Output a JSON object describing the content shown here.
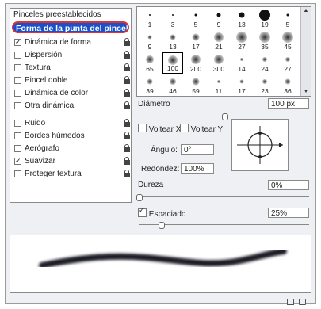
{
  "brush_panel": {
    "presets_label": "Pinceles preestablecidos",
    "brush_tip_shape_label": "Forma de la punta del pincel",
    "options": [
      {
        "label": "Dinámica de forma",
        "checked": true
      },
      {
        "label": "Dispersión",
        "checked": false
      },
      {
        "label": "Textura",
        "checked": false
      },
      {
        "label": "Pincel doble",
        "checked": false
      },
      {
        "label": "Dinámica de color",
        "checked": false
      },
      {
        "label": "Otra dinámica",
        "checked": false
      },
      {
        "label": "Ruido",
        "checked": false
      },
      {
        "label": "Bordes húmedos",
        "checked": false
      },
      {
        "label": "Aerógrafo",
        "checked": false
      },
      {
        "label": "Suavizar",
        "checked": true
      },
      {
        "label": "Proteger textura",
        "checked": false
      }
    ]
  },
  "brush_grid": {
    "rows": [
      [
        "1",
        "3",
        "5",
        "9",
        "13",
        "19",
        "5"
      ],
      [
        "9",
        "13",
        "17",
        "21",
        "27",
        "35",
        "45"
      ],
      [
        "65",
        "100",
        "200",
        "300",
        "14",
        "24",
        "27"
      ],
      [
        "39",
        "46",
        "59",
        "11",
        "17",
        "23",
        "36"
      ]
    ],
    "selected": "100"
  },
  "settings": {
    "diameter_label": "Diámetro",
    "diameter_value": "100 px",
    "flip_x_label": "Voltear X",
    "flip_y_label": "Voltear Y",
    "angle_label": "Ángulo:",
    "angle_value": "0°",
    "roundness_label": "Redondez:",
    "roundness_value": "100%",
    "hardness_label": "Dureza",
    "hardness_value": "0%",
    "spacing_label": "Espaciado",
    "spacing_value": "25%",
    "spacing_checked": true
  },
  "icons": {
    "lock": "lock-icon",
    "new_preset": "new-preset-icon",
    "delete": "trash-icon"
  }
}
